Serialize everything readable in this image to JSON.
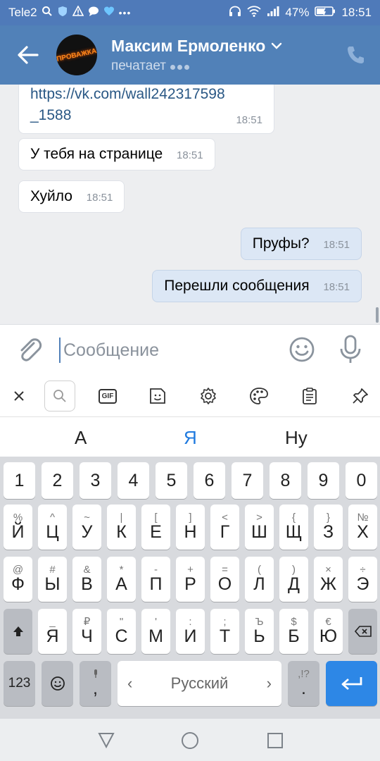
{
  "statusbar": {
    "carrier": "Tele2",
    "battery": "47%",
    "clock": "18:51"
  },
  "header": {
    "name": "Максим Ермоленко",
    "status": "печатает",
    "avatar_text": "ПРОВАЖКА"
  },
  "messages": [
    {
      "dir": "in",
      "text": "https://vk.com/wall242317598",
      "text2": "_1588",
      "time": "18:51",
      "link": true
    },
    {
      "dir": "in",
      "text": "У тебя на странице",
      "time": "18:51"
    },
    {
      "dir": "in",
      "text": "Хуйло",
      "time": "18:51"
    },
    {
      "dir": "out",
      "text": "Пруфы?",
      "time": "18:51"
    },
    {
      "dir": "out",
      "text": "Перешли сообщения",
      "time": "18:51"
    }
  ],
  "composer": {
    "placeholder": "Сообщение"
  },
  "toolbar": {
    "gif_label": "GIF"
  },
  "suggestions": [
    "А",
    "Я",
    "Ну"
  ],
  "keyboard": {
    "row0": [
      "1",
      "2",
      "3",
      "4",
      "5",
      "6",
      "7",
      "8",
      "9",
      "0"
    ],
    "row1": [
      {
        "sub": "%",
        "main": "Й"
      },
      {
        "sub": "^",
        "main": "Ц"
      },
      {
        "sub": "~",
        "main": "У"
      },
      {
        "sub": "|",
        "main": "К"
      },
      {
        "sub": "[",
        "main": "Е"
      },
      {
        "sub": "]",
        "main": "Н"
      },
      {
        "sub": "<",
        "main": "Г"
      },
      {
        "sub": ">",
        "main": "Ш"
      },
      {
        "sub": "{",
        "main": "Щ"
      },
      {
        "sub": "}",
        "main": "З"
      },
      {
        "sub": "№",
        "main": "Х"
      }
    ],
    "row2": [
      {
        "sub": "@",
        "main": "Ф"
      },
      {
        "sub": "#",
        "main": "Ы"
      },
      {
        "sub": "&",
        "main": "В"
      },
      {
        "sub": "*",
        "main": "А"
      },
      {
        "sub": "-",
        "main": "П"
      },
      {
        "sub": "+",
        "main": "Р"
      },
      {
        "sub": "=",
        "main": "О"
      },
      {
        "sub": "(",
        "main": "Л"
      },
      {
        "sub": ")",
        "main": "Д"
      },
      {
        "sub": "×",
        "main": "Ж"
      },
      {
        "sub": "÷",
        "main": "Э"
      }
    ],
    "row3": [
      {
        "sub": "_",
        "main": "Я"
      },
      {
        "sub": "₽",
        "main": "Ч"
      },
      {
        "sub": "\"",
        "main": "С"
      },
      {
        "sub": "'",
        "main": "М"
      },
      {
        "sub": ":",
        "main": "И"
      },
      {
        "sub": ";",
        "main": "Т"
      },
      {
        "sub": "Ъ",
        "main": "Ь"
      },
      {
        "sub": "$",
        "main": "Б"
      },
      {
        "sub": "€",
        "main": "Ю"
      }
    ],
    "num_label": "123",
    "comma": ",",
    "space_label": "Русский",
    "period_sub": ",!?",
    "period": ".",
    "space_left": "‹",
    "space_right": "›"
  },
  "colors": {
    "header": "#5181b8",
    "accent": "#2d87e6"
  }
}
